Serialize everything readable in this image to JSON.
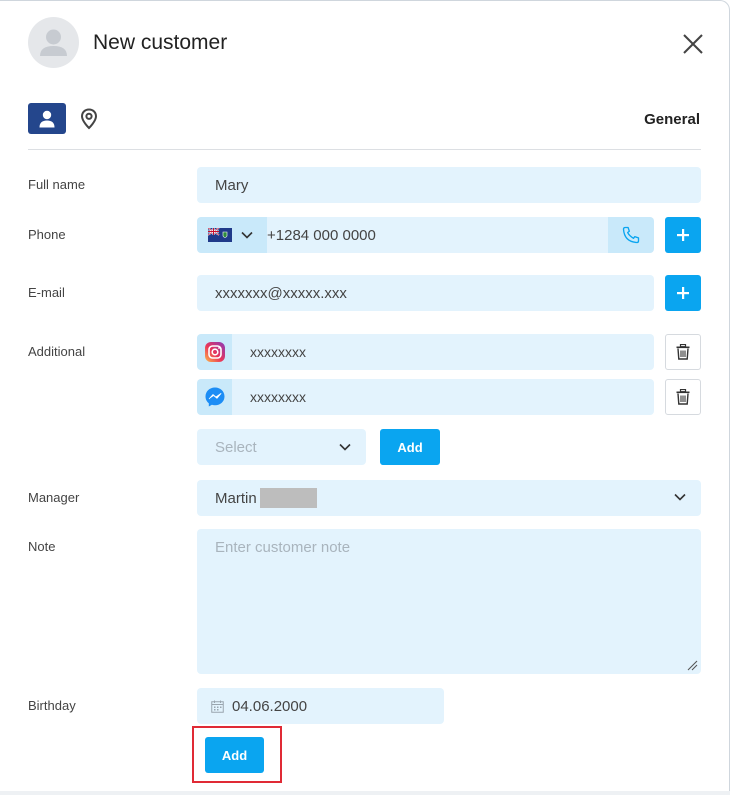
{
  "header": {
    "title": "New customer"
  },
  "tabs": {
    "person_icon": "person-icon",
    "location_icon": "location-pin-icon",
    "active_label": "General"
  },
  "form": {
    "full_name": {
      "label": "Full name",
      "value": "Mary"
    },
    "phone": {
      "label": "Phone",
      "country_flag": "british-virgin-islands-flag",
      "value": "+1284 000 0000"
    },
    "email": {
      "label": "E-mail",
      "value": "xxxxxxx@xxxxx.xxx"
    },
    "additional": {
      "label": "Additional",
      "items": [
        {
          "icon": "instagram-icon",
          "value": "xxxxxxxx"
        },
        {
          "icon": "messenger-icon",
          "value": "xxxxxxxx"
        }
      ],
      "select_placeholder": "Select",
      "add_label": "Add"
    },
    "manager": {
      "label": "Manager",
      "value": "Martin"
    },
    "note": {
      "label": "Note",
      "placeholder": "Enter customer note"
    },
    "birthday": {
      "label": "Birthday",
      "value": "04.06.2000"
    },
    "submit_label": "Add"
  },
  "colors": {
    "accent": "#0aa5f0",
    "tab_active": "#24468c",
    "field_bg": "#e3f3fd",
    "highlight": "#e02a35"
  }
}
